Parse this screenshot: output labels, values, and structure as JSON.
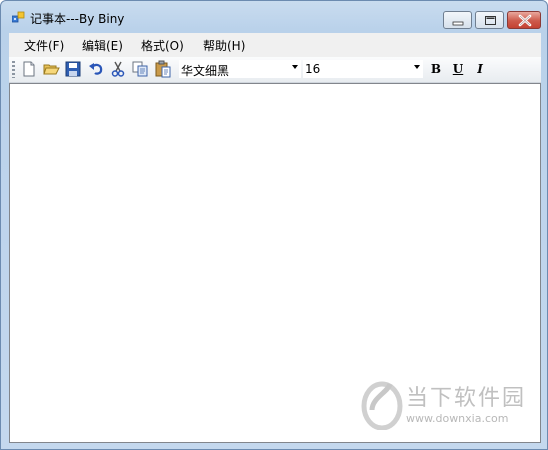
{
  "window": {
    "title": "记事本---By Biny"
  },
  "menu": [
    {
      "label": "文件(F)"
    },
    {
      "label": "编辑(E)"
    },
    {
      "label": "格式(O)"
    },
    {
      "label": "帮助(H)"
    }
  ],
  "toolbar": {
    "buttons": [
      "new-file-icon",
      "open-folder-icon",
      "save-icon",
      "undo-icon",
      "cut-icon",
      "copy-icon",
      "paste-icon"
    ],
    "font_name": "华文细黑",
    "font_size": "16",
    "bold_label": "B",
    "underline_label": "U",
    "italic_label": "I"
  },
  "editor": {
    "content": ""
  },
  "watermark": {
    "text": "当下软件园",
    "url": "www.downxia.com"
  }
}
